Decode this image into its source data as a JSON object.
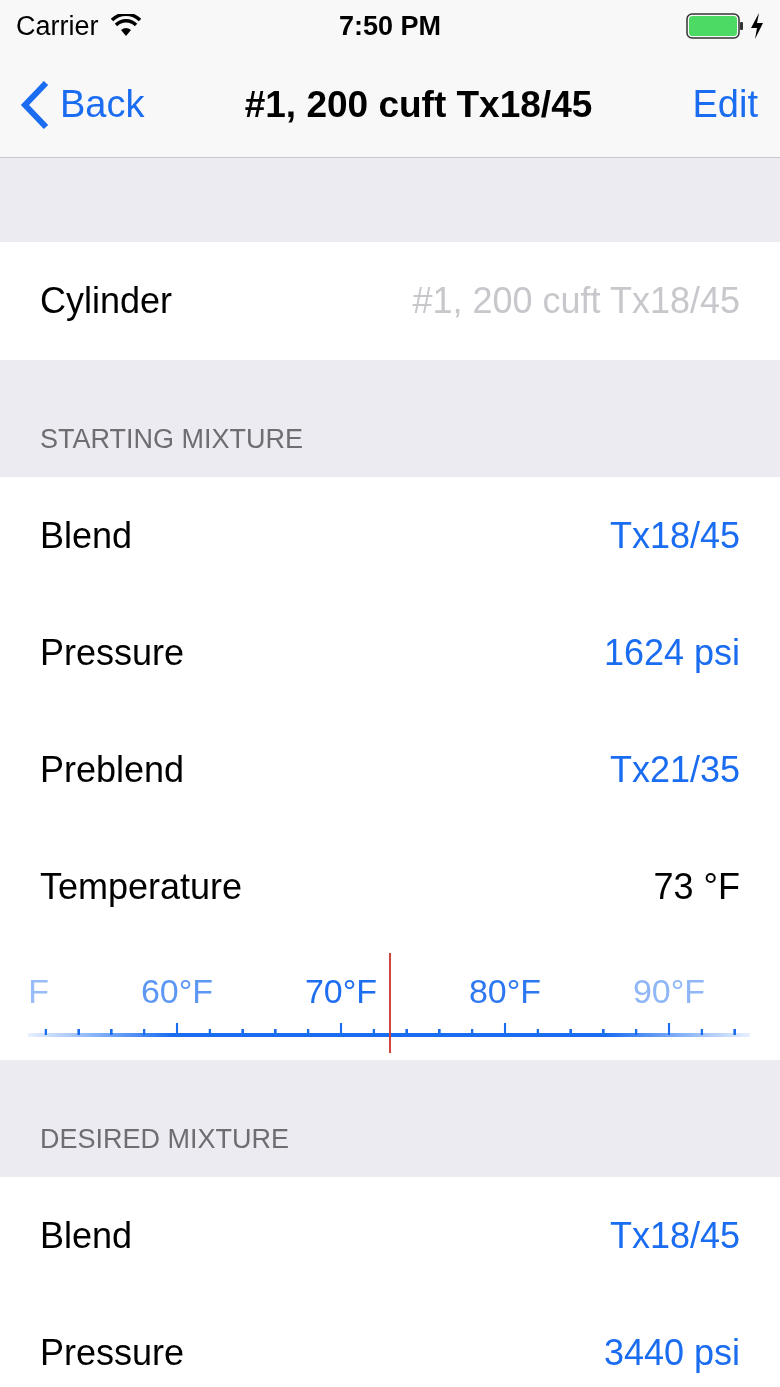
{
  "status_bar": {
    "carrier": "Carrier",
    "time": "7:50 PM"
  },
  "nav": {
    "back": "Back",
    "title": "#1, 200 cuft Tx18/45",
    "action": "Edit"
  },
  "cylinder": {
    "label": "Cylinder",
    "value": "#1, 200 cuft Tx18/45"
  },
  "sections": [
    {
      "header": "STARTING MIXTURE",
      "rows": [
        {
          "kind": "link",
          "label": "Blend",
          "value": "Tx18/45"
        },
        {
          "kind": "link",
          "label": "Pressure",
          "value": "1624 psi"
        },
        {
          "kind": "link",
          "label": "Preblend",
          "value": "Tx21/35"
        },
        {
          "kind": "plain",
          "label": "Temperature",
          "value": "73 °F"
        },
        {
          "kind": "ruler",
          "labels": [
            {
              "text": "F"
            },
            {
              "text": "60°F"
            },
            {
              "text": "70°F"
            },
            {
              "text": "80°F"
            },
            {
              "text": "90°F"
            }
          ]
        }
      ]
    },
    {
      "header": "DESIRED MIXTURE",
      "rows": [
        {
          "kind": "link",
          "label": "Blend",
          "value": "Tx18/45"
        },
        {
          "kind": "link",
          "label": "Pressure",
          "value": "3440 psi"
        }
      ]
    }
  ]
}
